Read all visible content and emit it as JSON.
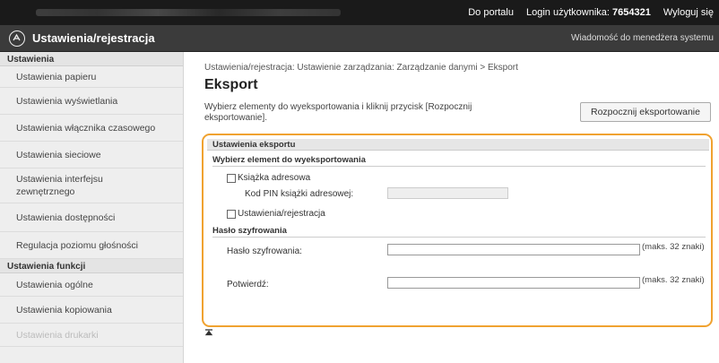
{
  "topbar": {
    "portal": "Do portalu",
    "login_label": "Login użytkownika:",
    "login_id": "7654321",
    "logout": "Wyloguj się"
  },
  "header": {
    "title": "Ustawienia/rejestracja",
    "message": "Wiadomość do menedżera systemu"
  },
  "sidebar": {
    "section1": "Ustawienia",
    "items1": [
      "Ustawienia papieru",
      "Ustawienia wyświetlania",
      "Ustawienia włącznika czasowego",
      "Ustawienia sieciowe",
      "Ustawienia interfejsu zewnętrznego",
      "Ustawienia dostępności",
      "Regulacja poziomu głośności"
    ],
    "section2": "Ustawienia funkcji",
    "items2": [
      "Ustawienia ogólne",
      "Ustawienia kopiowania",
      "Ustawienia drukarki"
    ]
  },
  "main": {
    "breadcrumb": "Ustawienia/rejestracja: Ustawienie zarządzania: Zarządzanie danymi > Eksport",
    "title": "Eksport",
    "description": "Wybierz elementy do wyeksportowania i kliknij przycisk [Rozpocznij eksportowanie].",
    "start_button": "Rozpocznij eksportowanie",
    "section_title": "Ustawienia eksportu",
    "select_heading": "Wybierz element do wyeksportowania",
    "checkbox_address_book": "Książka adresowa",
    "pin_label": "Kod PIN książki adresowej:",
    "checkbox_settings": "Ustawienia/rejestracja",
    "encryption_heading": "Hasło szyfrowania",
    "password_label": "Hasło szyfrowania:",
    "password_hint": "(maks. 32 znaki)",
    "confirm_label": "Potwierdź:",
    "confirm_hint": "(maks. 32 znaki)"
  },
  "colors": {
    "highlight_frame": "#f0a230",
    "header_bg": "#3b3b3b",
    "topbar_bg": "#1a1a1a"
  }
}
